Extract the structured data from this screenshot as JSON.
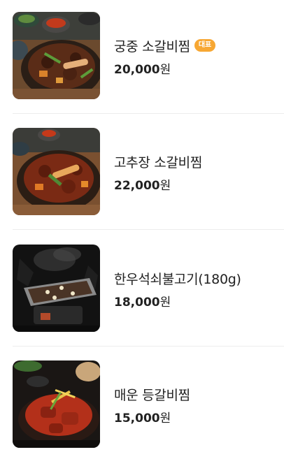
{
  "menu": {
    "items": [
      {
        "name": "궁중 소갈비찜",
        "badge": "대표",
        "price": "20,000",
        "unit": "원",
        "image": "braised-galbi-royal"
      },
      {
        "name": "고추장 소갈비찜",
        "badge": "",
        "price": "22,000",
        "unit": "원",
        "image": "braised-galbi-gochujang"
      },
      {
        "name": "한우석쇠불고기(180g)",
        "badge": "",
        "price": "18,000",
        "unit": "원",
        "image": "hanwoo-grill-bulgogi"
      },
      {
        "name": "매운 등갈비찜",
        "badge": "",
        "price": "15,000",
        "unit": "원",
        "image": "spicy-back-ribs"
      }
    ]
  },
  "colors": {
    "badge": "#f7a733",
    "divider": "#ececec",
    "text": "#222222"
  }
}
